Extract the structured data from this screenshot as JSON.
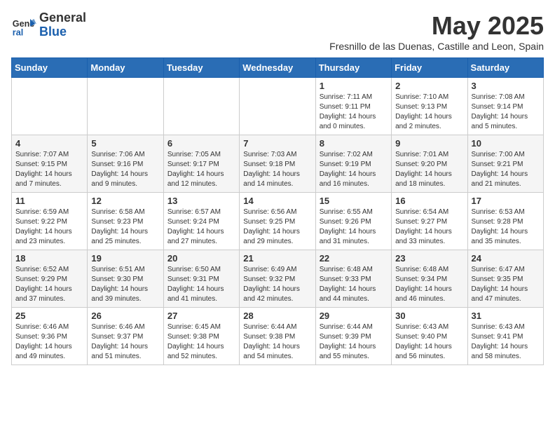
{
  "header": {
    "logo_general": "General",
    "logo_blue": "Blue",
    "month_title": "May 2025",
    "subtitle": "Fresnillo de las Duenas, Castille and Leon, Spain"
  },
  "days_of_week": [
    "Sunday",
    "Monday",
    "Tuesday",
    "Wednesday",
    "Thursday",
    "Friday",
    "Saturday"
  ],
  "weeks": [
    [
      {
        "day": "",
        "info": ""
      },
      {
        "day": "",
        "info": ""
      },
      {
        "day": "",
        "info": ""
      },
      {
        "day": "",
        "info": ""
      },
      {
        "day": "1",
        "info": "Sunrise: 7:11 AM\nSunset: 9:11 PM\nDaylight: 14 hours\nand 0 minutes."
      },
      {
        "day": "2",
        "info": "Sunrise: 7:10 AM\nSunset: 9:13 PM\nDaylight: 14 hours\nand 2 minutes."
      },
      {
        "day": "3",
        "info": "Sunrise: 7:08 AM\nSunset: 9:14 PM\nDaylight: 14 hours\nand 5 minutes."
      }
    ],
    [
      {
        "day": "4",
        "info": "Sunrise: 7:07 AM\nSunset: 9:15 PM\nDaylight: 14 hours\nand 7 minutes."
      },
      {
        "day": "5",
        "info": "Sunrise: 7:06 AM\nSunset: 9:16 PM\nDaylight: 14 hours\nand 9 minutes."
      },
      {
        "day": "6",
        "info": "Sunrise: 7:05 AM\nSunset: 9:17 PM\nDaylight: 14 hours\nand 12 minutes."
      },
      {
        "day": "7",
        "info": "Sunrise: 7:03 AM\nSunset: 9:18 PM\nDaylight: 14 hours\nand 14 minutes."
      },
      {
        "day": "8",
        "info": "Sunrise: 7:02 AM\nSunset: 9:19 PM\nDaylight: 14 hours\nand 16 minutes."
      },
      {
        "day": "9",
        "info": "Sunrise: 7:01 AM\nSunset: 9:20 PM\nDaylight: 14 hours\nand 18 minutes."
      },
      {
        "day": "10",
        "info": "Sunrise: 7:00 AM\nSunset: 9:21 PM\nDaylight: 14 hours\nand 21 minutes."
      }
    ],
    [
      {
        "day": "11",
        "info": "Sunrise: 6:59 AM\nSunset: 9:22 PM\nDaylight: 14 hours\nand 23 minutes."
      },
      {
        "day": "12",
        "info": "Sunrise: 6:58 AM\nSunset: 9:23 PM\nDaylight: 14 hours\nand 25 minutes."
      },
      {
        "day": "13",
        "info": "Sunrise: 6:57 AM\nSunset: 9:24 PM\nDaylight: 14 hours\nand 27 minutes."
      },
      {
        "day": "14",
        "info": "Sunrise: 6:56 AM\nSunset: 9:25 PM\nDaylight: 14 hours\nand 29 minutes."
      },
      {
        "day": "15",
        "info": "Sunrise: 6:55 AM\nSunset: 9:26 PM\nDaylight: 14 hours\nand 31 minutes."
      },
      {
        "day": "16",
        "info": "Sunrise: 6:54 AM\nSunset: 9:27 PM\nDaylight: 14 hours\nand 33 minutes."
      },
      {
        "day": "17",
        "info": "Sunrise: 6:53 AM\nSunset: 9:28 PM\nDaylight: 14 hours\nand 35 minutes."
      }
    ],
    [
      {
        "day": "18",
        "info": "Sunrise: 6:52 AM\nSunset: 9:29 PM\nDaylight: 14 hours\nand 37 minutes."
      },
      {
        "day": "19",
        "info": "Sunrise: 6:51 AM\nSunset: 9:30 PM\nDaylight: 14 hours\nand 39 minutes."
      },
      {
        "day": "20",
        "info": "Sunrise: 6:50 AM\nSunset: 9:31 PM\nDaylight: 14 hours\nand 41 minutes."
      },
      {
        "day": "21",
        "info": "Sunrise: 6:49 AM\nSunset: 9:32 PM\nDaylight: 14 hours\nand 42 minutes."
      },
      {
        "day": "22",
        "info": "Sunrise: 6:48 AM\nSunset: 9:33 PM\nDaylight: 14 hours\nand 44 minutes."
      },
      {
        "day": "23",
        "info": "Sunrise: 6:48 AM\nSunset: 9:34 PM\nDaylight: 14 hours\nand 46 minutes."
      },
      {
        "day": "24",
        "info": "Sunrise: 6:47 AM\nSunset: 9:35 PM\nDaylight: 14 hours\nand 47 minutes."
      }
    ],
    [
      {
        "day": "25",
        "info": "Sunrise: 6:46 AM\nSunset: 9:36 PM\nDaylight: 14 hours\nand 49 minutes."
      },
      {
        "day": "26",
        "info": "Sunrise: 6:46 AM\nSunset: 9:37 PM\nDaylight: 14 hours\nand 51 minutes."
      },
      {
        "day": "27",
        "info": "Sunrise: 6:45 AM\nSunset: 9:38 PM\nDaylight: 14 hours\nand 52 minutes."
      },
      {
        "day": "28",
        "info": "Sunrise: 6:44 AM\nSunset: 9:38 PM\nDaylight: 14 hours\nand 54 minutes."
      },
      {
        "day": "29",
        "info": "Sunrise: 6:44 AM\nSunset: 9:39 PM\nDaylight: 14 hours\nand 55 minutes."
      },
      {
        "day": "30",
        "info": "Sunrise: 6:43 AM\nSunset: 9:40 PM\nDaylight: 14 hours\nand 56 minutes."
      },
      {
        "day": "31",
        "info": "Sunrise: 6:43 AM\nSunset: 9:41 PM\nDaylight: 14 hours\nand 58 minutes."
      }
    ]
  ]
}
